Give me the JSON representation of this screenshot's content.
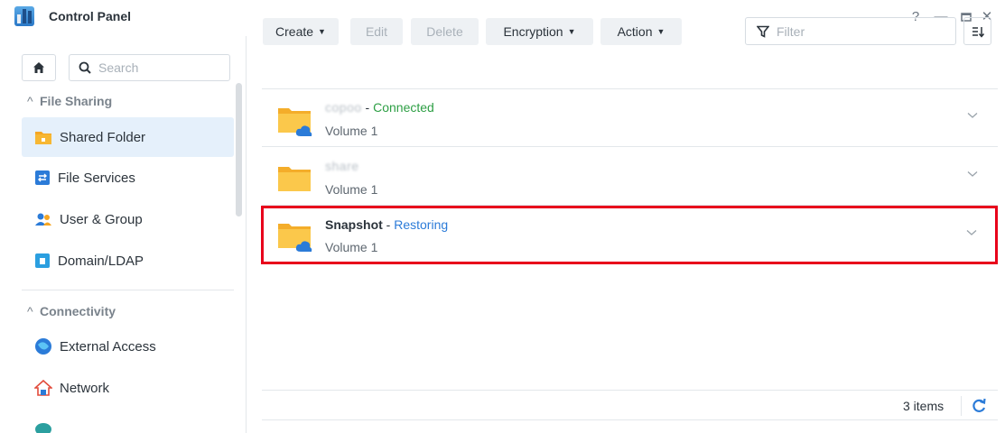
{
  "window": {
    "title": "Control Panel",
    "buttons": {
      "help": "?",
      "minimize": "—",
      "maximize": "▭",
      "close": "✕"
    }
  },
  "sidebar": {
    "search_placeholder": "Search",
    "sections": [
      {
        "label": "File Sharing",
        "expanded": true
      },
      {
        "label": "Connectivity",
        "expanded": true
      }
    ],
    "items": [
      {
        "label": "Shared Folder",
        "active": true,
        "icon": "shared-folder-icon"
      },
      {
        "label": "File Services",
        "active": false,
        "icon": "file-services-icon"
      },
      {
        "label": "User & Group",
        "active": false,
        "icon": "user-group-icon"
      },
      {
        "label": "Domain/LDAP",
        "active": false,
        "icon": "domain-ldap-icon"
      },
      {
        "label": "External Access",
        "active": false,
        "icon": "external-access-icon"
      },
      {
        "label": "Network",
        "active": false,
        "icon": "network-icon"
      }
    ]
  },
  "toolbar": {
    "create": "Create",
    "edit": "Edit",
    "delete": "Delete",
    "encryption": "Encryption",
    "action": "Action",
    "filter_placeholder": "Filter"
  },
  "folders": [
    {
      "name": "copoo",
      "name_obscured": true,
      "status": "Connected",
      "volume": "Volume 1",
      "cloud": true
    },
    {
      "name": "share",
      "name_obscured": true,
      "status": "",
      "volume": "Volume 1",
      "cloud": false
    },
    {
      "name": "Snapshot",
      "name_obscured": false,
      "status": "Restoring",
      "volume": "Volume 1",
      "cloud": true,
      "highlighted": true
    }
  ],
  "footer": {
    "items_count": "3 items"
  },
  "colors": {
    "accent": "#2b7bd8",
    "connected": "#2e9f45",
    "highlight_border": "#e8001b",
    "active_nav_bg": "#e5f0fb",
    "folder": "#f9c13c"
  }
}
